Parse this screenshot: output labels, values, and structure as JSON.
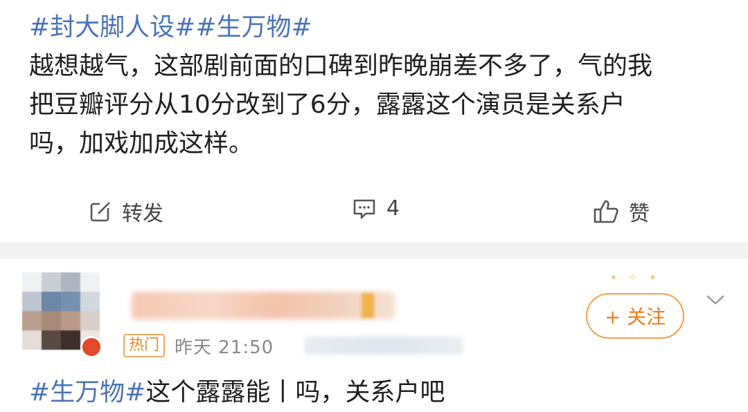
{
  "post": {
    "hashtags": "#封大脚人设##生万物#",
    "line1": "越想越气，这部剧前面的口碑到昨晚崩差不多了，气的我",
    "line2": "把豆瓣评分从10分改到了6分，露露这个演员是关系户",
    "line3": "吗，加戏加成这样。"
  },
  "actions": {
    "repost_label": "转发",
    "comment_count": "4",
    "like_label": "赞",
    "repost_icon": "share-edit-icon",
    "comment_icon": "comment-bubble-icon",
    "like_icon": "thumbs-up-icon"
  },
  "user_card": {
    "hot_tag": "热门",
    "time_text": "昨天 21:50",
    "follow_label": "+ 关注",
    "comment_hashtag": "#生万物#",
    "comment_text": "这个露露能丨吗，关系户吧"
  },
  "colors": {
    "hashtag": "#4a74b8",
    "follow": "#e87d1a",
    "divider": "#f2f2f2"
  }
}
